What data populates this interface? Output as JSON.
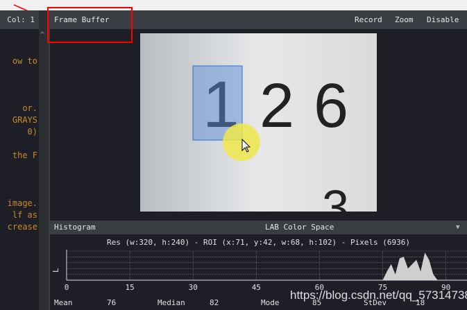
{
  "editor": {
    "status": "Col: 1",
    "lines": [
      "ow to",
      "or.",
      "GRAYS",
      "0)",
      "the F",
      "image.",
      "lf as",
      "crease"
    ]
  },
  "framebuffer": {
    "title": "Frame Buffer",
    "record": "Record",
    "zoom": "Zoom",
    "disable": "Disable",
    "digits": [
      "1",
      "2",
      "6",
      "3"
    ]
  },
  "histogram": {
    "title": "Histogram",
    "color_space": "LAB Color Space",
    "info": "Res (w:320, h:240) - ROI (x:71, y:42, w:68, h:102) - Pixels (6936)",
    "channel": "L",
    "ticks": [
      "0",
      "15",
      "30",
      "45",
      "60",
      "75",
      "90"
    ],
    "stats": [
      {
        "label": "Mean",
        "value": "76"
      },
      {
        "label": "Median",
        "value": "82"
      },
      {
        "label": "Mode",
        "value": "85"
      },
      {
        "label": "StDev",
        "value": "18"
      }
    ]
  },
  "watermark": "https://blog.csdn.net/qq_57314738",
  "chart_data": {
    "type": "area",
    "xlim": [
      0,
      95
    ],
    "x_ticks": [
      0,
      15,
      30,
      45,
      60,
      75,
      90
    ],
    "ylabel": "L",
    "x": [
      75,
      76,
      77,
      78,
      79,
      80,
      81,
      82,
      83,
      84,
      85,
      86,
      87,
      88
    ],
    "values": [
      0,
      30,
      55,
      20,
      75,
      80,
      40,
      55,
      70,
      30,
      95,
      70,
      20,
      0
    ]
  }
}
